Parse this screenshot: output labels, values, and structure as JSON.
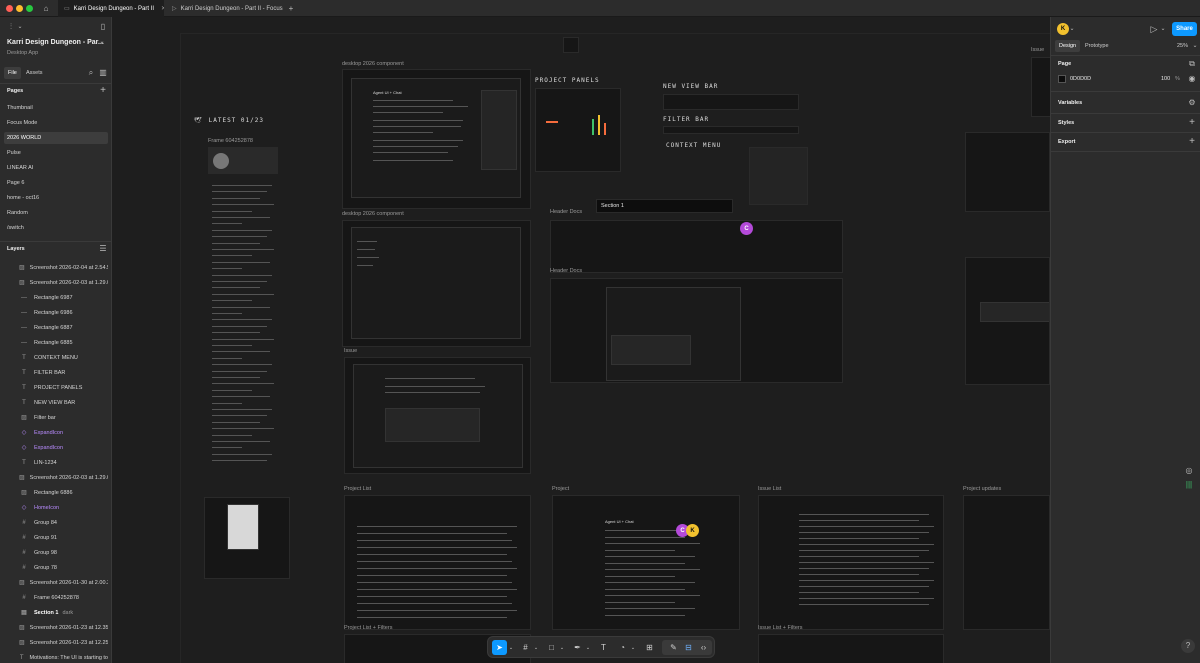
{
  "tabs": {
    "home_icon": "home-icon",
    "tab1": "Karri Design Dungeon - Part II",
    "tab2": "Karri Design Dungeon - Part II - Focus"
  },
  "left_panel": {
    "project_title": "Karri Design Dungeon - Par...",
    "project_subtitle": "Desktop App",
    "file_tabs": [
      "File",
      "Assets"
    ],
    "pages_heading": "Pages",
    "pages": [
      "Thumbnail",
      "Focus Mode",
      "2026 WORLD",
      "Pulse",
      "LINEAR AI",
      "Page 6",
      "home - oct16",
      "Random",
      "/switch"
    ],
    "selected_page": "2026 WORLD",
    "layers_heading": "Layers",
    "layers": [
      {
        "icon": "image-icon",
        "label": "Screenshot 2026-02-04 at 2.54.5"
      },
      {
        "icon": "image-icon",
        "label": "Screenshot 2026-02-03 at 1.29.0"
      },
      {
        "icon": "line-icon",
        "label": "Rectangle 6987"
      },
      {
        "icon": "line-icon",
        "label": "Rectangle 6986"
      },
      {
        "icon": "line-icon",
        "label": "Rectangle 6887"
      },
      {
        "icon": "line-icon",
        "label": "Rectangle 6885"
      },
      {
        "icon": "text-icon",
        "label": "CONTEXT MENU"
      },
      {
        "icon": "text-icon",
        "label": "FILTER BAR"
      },
      {
        "icon": "text-icon",
        "label": "PROJECT PANELS"
      },
      {
        "icon": "text-icon",
        "label": "NEW VIEW BAR"
      },
      {
        "icon": "image-icon",
        "label": "Filter bar"
      },
      {
        "icon": "component-icon",
        "label": "ExpandIcon"
      },
      {
        "icon": "component-icon",
        "label": "ExpandIcon"
      },
      {
        "icon": "text-icon",
        "label": "LIN-1234"
      },
      {
        "icon": "image-icon",
        "label": "Screenshot 2026-02-03 at 1.29.0"
      },
      {
        "icon": "image-icon",
        "label": "Rectangle 6886"
      },
      {
        "icon": "component-icon",
        "label": "HomeIcon"
      },
      {
        "icon": "frame-icon",
        "label": "Group 84"
      },
      {
        "icon": "frame-icon",
        "label": "Group 91"
      },
      {
        "icon": "frame-icon",
        "label": "Group 98"
      },
      {
        "icon": "frame-icon",
        "label": "Group 78"
      },
      {
        "icon": "image-icon",
        "label": "Screenshot 2026-01-30 at 2.00.3"
      },
      {
        "icon": "frame-icon",
        "label": "Frame 604252878"
      },
      {
        "icon": "section-icon",
        "label": "Section 1",
        "suffix": "dark"
      },
      {
        "icon": "image-icon",
        "label": "Screenshot 2026-01-23 at 12.35.2"
      },
      {
        "icon": "image-icon",
        "label": "Screenshot 2026-01-23 at 12.25.5"
      },
      {
        "icon": "text-icon",
        "label": "Motivations: The UI is starting to"
      }
    ]
  },
  "canvas": {
    "labels": {
      "desktop1": "desktop 2026 component",
      "desktop2": "desktop 2026 component",
      "project_panels": "PROJECT PANELS",
      "new_view_bar": "NEW VIEW BAR",
      "filter_bar": "FILTER BAR",
      "context_menu": "CONTEXT MENU",
      "section1": "Section 1",
      "header_docs1": "Header Docs",
      "header_docs2": "Header Docs",
      "issue_top": "Issue",
      "issue": "Issue",
      "latest": "LATEST 01/23",
      "frame_label": "Frame 604252878",
      "project_list": "Project List",
      "project": "Project",
      "issue_list": "Issue List",
      "project_updates": "Project updates",
      "project_list_filters": "Project List + Filters",
      "issue_list_filters": "Issue List + Filters",
      "agent_chat": "Agent UI + Chat",
      "agent_chat2": "Agent UI + Chat"
    },
    "cursors": [
      {
        "letter": "C",
        "color": "#b44ad9"
      },
      {
        "letter": "C",
        "color": "#b44ad9"
      },
      {
        "letter": "K",
        "color": "#f2c12e"
      }
    ]
  },
  "right_panel": {
    "avatar_letter": "K",
    "share_label": "Share",
    "tabs": [
      "Design",
      "Prototype"
    ],
    "zoom": "25%",
    "page_heading": "Page",
    "page_color": "0D0D0D",
    "page_opacity": "100",
    "percent": "%",
    "sections": [
      "Variables",
      "Styles",
      "Export"
    ],
    "help": "?"
  },
  "toolbar": {
    "tools": [
      "move-icon",
      "frame-icon",
      "rectangle-icon",
      "pen-icon",
      "text-icon",
      "shape-icon",
      "components-icon",
      "dev-mode-icon",
      "grid-icon",
      "code-icon"
    ]
  },
  "colors": {
    "accent": "#0d99ff",
    "component": "#b98cff",
    "panel": "#2c2c2c",
    "canvas": "#1e1e1e"
  }
}
